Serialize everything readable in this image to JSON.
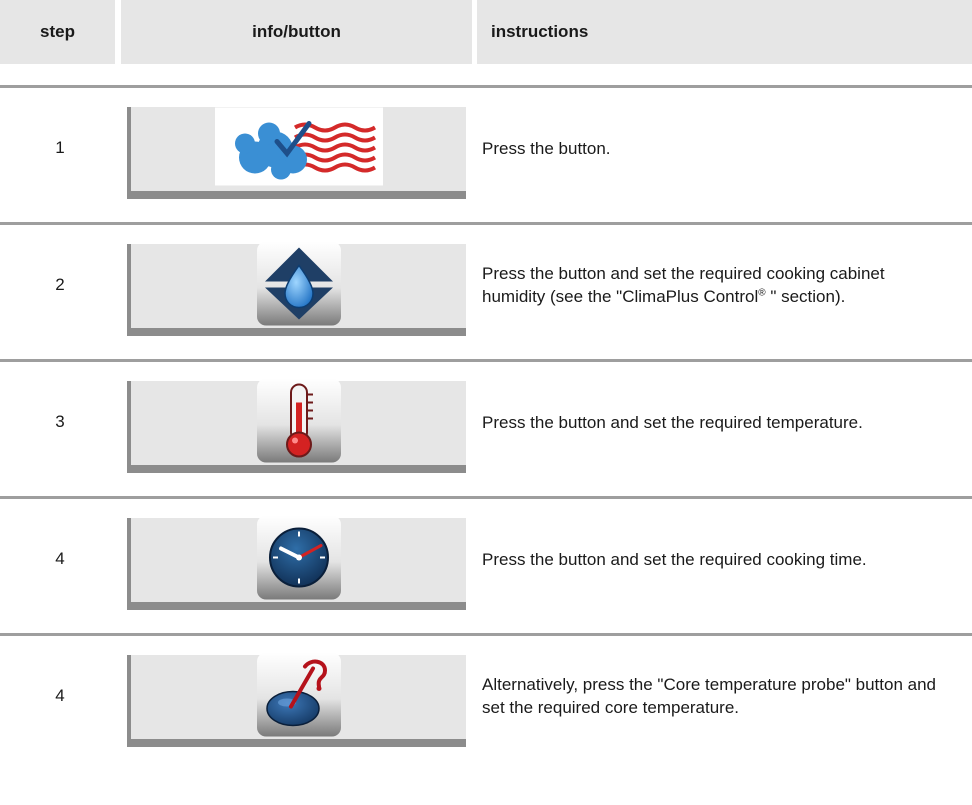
{
  "header": {
    "step": "step",
    "info": "info/button",
    "instructions": "instructions"
  },
  "rows": [
    {
      "step": "1",
      "icon": "steam-flag-icon",
      "text": "Press the button."
    },
    {
      "step": "2",
      "icon": "humidity-control-icon",
      "text_before": "Press the button and set the required cooking cabinet humidity (see the \"ClimaPlus Control",
      "reg": "®",
      "text_after": " \" section)."
    },
    {
      "step": "3",
      "icon": "thermometer-icon",
      "text": "Press the button and set the required temperature."
    },
    {
      "step": "4",
      "icon": "clock-icon",
      "text": "Press the button and set the required cooking time."
    },
    {
      "step": "4",
      "icon": "core-temperature-probe-icon",
      "text": "Alternatively, press the \"Core temperature probe\" button and set the required core temperature."
    }
  ]
}
